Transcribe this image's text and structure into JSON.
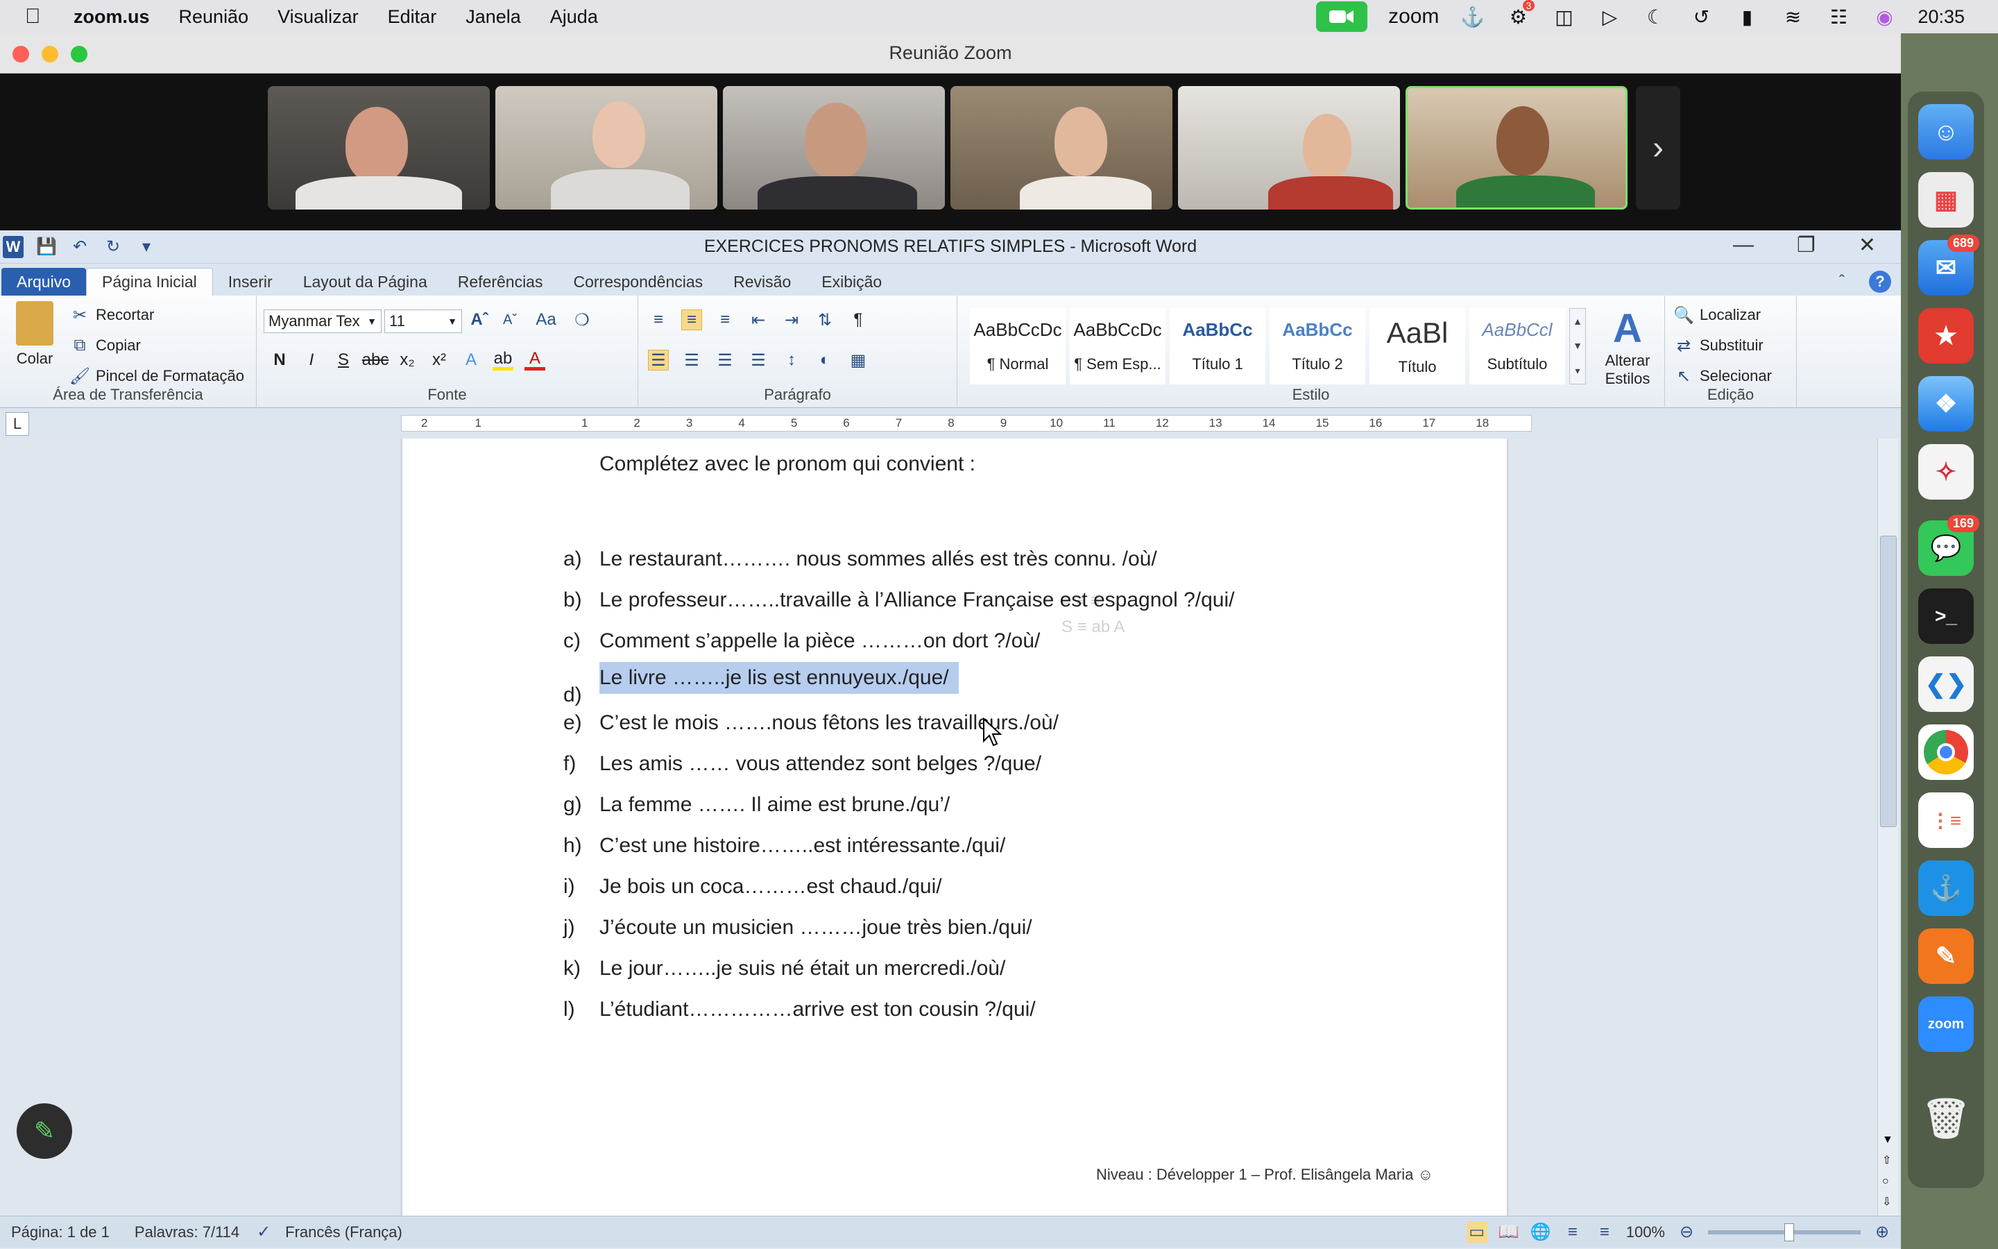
{
  "menubar": {
    "app": "zoom.us",
    "items": [
      "Reunião",
      "Visualizar",
      "Editar",
      "Janela",
      "Ajuda"
    ],
    "zoom_label": "zoom",
    "clock": "20:35",
    "badge_count": "3"
  },
  "zoom": {
    "window_title": "Reunião Zoom"
  },
  "word": {
    "title": "EXERCICES PRONOMS RELATIFS SIMPLES  -  Microsoft Word",
    "tabs": [
      "Arquivo",
      "Página Inicial",
      "Inserir",
      "Layout da Página",
      "Referências",
      "Correspondências",
      "Revisão",
      "Exibição"
    ],
    "clipboard": {
      "paste": "Colar",
      "cut": "Recortar",
      "copy": "Copiar",
      "format_painter": "Pincel de Formatação",
      "label": "Área de Transferência"
    },
    "font": {
      "name": "Myanmar Tex",
      "size": "11",
      "label": "Fonte"
    },
    "paragraph_label": "Parágrafo",
    "styles": [
      {
        "preview": "AaBbCcDc",
        "name": "¶ Normal"
      },
      {
        "preview": "AaBbCcDc",
        "name": "¶ Sem Esp..."
      },
      {
        "preview": "AaBbCc",
        "name": "Título 1"
      },
      {
        "preview": "AaBbCc",
        "name": "Título 2"
      },
      {
        "preview": "AaBl",
        "name": "Título"
      },
      {
        "preview": "AaBbCcl",
        "name": "Subtítulo"
      }
    ],
    "change_styles": "Alterar Estilos",
    "styles_label": "Estilo",
    "editing": {
      "find": "Localizar",
      "replace": "Substituir",
      "select": "Selecionar",
      "label": "Edição"
    },
    "ruler_numbers": [
      "2",
      "1",
      "1",
      "2",
      "3",
      "4",
      "5",
      "6",
      "7",
      "8",
      "9",
      "10",
      "11",
      "12",
      "13",
      "14",
      "15",
      "16",
      "17",
      "18"
    ],
    "document": {
      "instruction": "Complétez avec le pronom qui convient :",
      "exercises": [
        {
          "letter": "a)",
          "text": "Le restaurant………. nous sommes allés est très connu. /où/"
        },
        {
          "letter": "b)",
          "text": "Le professeur……..travaille à l’Alliance Française est espagnol ?/qui/"
        },
        {
          "letter": "c)",
          "text": "Comment s’appelle la pièce ………on dort ?/où/"
        },
        {
          "letter": "d)",
          "text": "Le livre ……..je lis est ennuyeux./que/"
        },
        {
          "letter": "e)",
          "text": "C’est le mois …….nous fêtons les travailleurs./où/"
        },
        {
          "letter": "f)",
          "text": "Les amis …… vous attendez sont belges ?/que/"
        },
        {
          "letter": "g)",
          "text": "La femme ……. Il aime est brune./qu’/"
        },
        {
          "letter": "h)",
          "text": "C’est une histoire……..est intéressante./qui/"
        },
        {
          "letter": "i)",
          "text": "Je bois un coca………est chaud./qui/"
        },
        {
          "letter": "j)",
          "text": "J’écoute un musicien ………joue très bien./qui/"
        },
        {
          "letter": "k)",
          "text": "Le jour……..je suis né  était un mercredi./où/"
        },
        {
          "letter": "l)",
          "text": "L’étudiant……………arrive est ton cousin ?/qui/"
        }
      ],
      "footer": "Niveau : Développer 1 – Prof. Elisângela Maria ☺"
    },
    "status": {
      "page": "Página: 1 de 1",
      "words": "Palavras: 7/114",
      "language": "Francês (França)",
      "zoom": "100%"
    }
  },
  "dock": {
    "mail_badge": "689",
    "messages_badge": "169",
    "zoom_label": "zoom"
  },
  "colors": {
    "word_blue": "#2a5fb0",
    "selection": "#b6cdee",
    "zoom_green": "#2fc248",
    "speaker_border": "#7ee06b"
  }
}
